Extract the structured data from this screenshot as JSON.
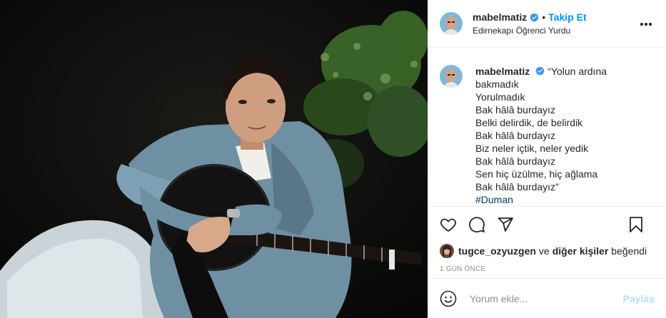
{
  "post": {
    "username": "mabelmatiz",
    "verified": true,
    "separator": "•",
    "follow_label": "Takip Et",
    "location": "Edirnekapı Öğrenci Yurdu"
  },
  "caption": {
    "username": "mabelmatiz",
    "lines": [
      "“Yolun ardına",
      "bakmadık",
      "Yorulmadık",
      "Bak hâlâ burdayız",
      "Belki delirdik, de belirdik",
      "Bak hâlâ burdayız",
      "Biz neler içtik, neler yedik",
      "Bak hâlâ burdayız",
      "Sen hiç üzülme, hiç ağlama",
      "Bak hâlâ burdayız”"
    ],
    "hashtag": "#Duman"
  },
  "likes": {
    "user": "tugce_ozyuzgen",
    "connector": "ve",
    "others": "diğer kişiler",
    "suffix": "beğendi"
  },
  "timestamp": "1 GÜN ÖNCE",
  "comment": {
    "placeholder": "Yorum ekle...",
    "share_label": "Paylaş"
  },
  "colors": {
    "accent": "#0095f6",
    "hashtag": "#00376b",
    "muted": "#8e8e8e",
    "share_disabled": "#b2dffc"
  }
}
